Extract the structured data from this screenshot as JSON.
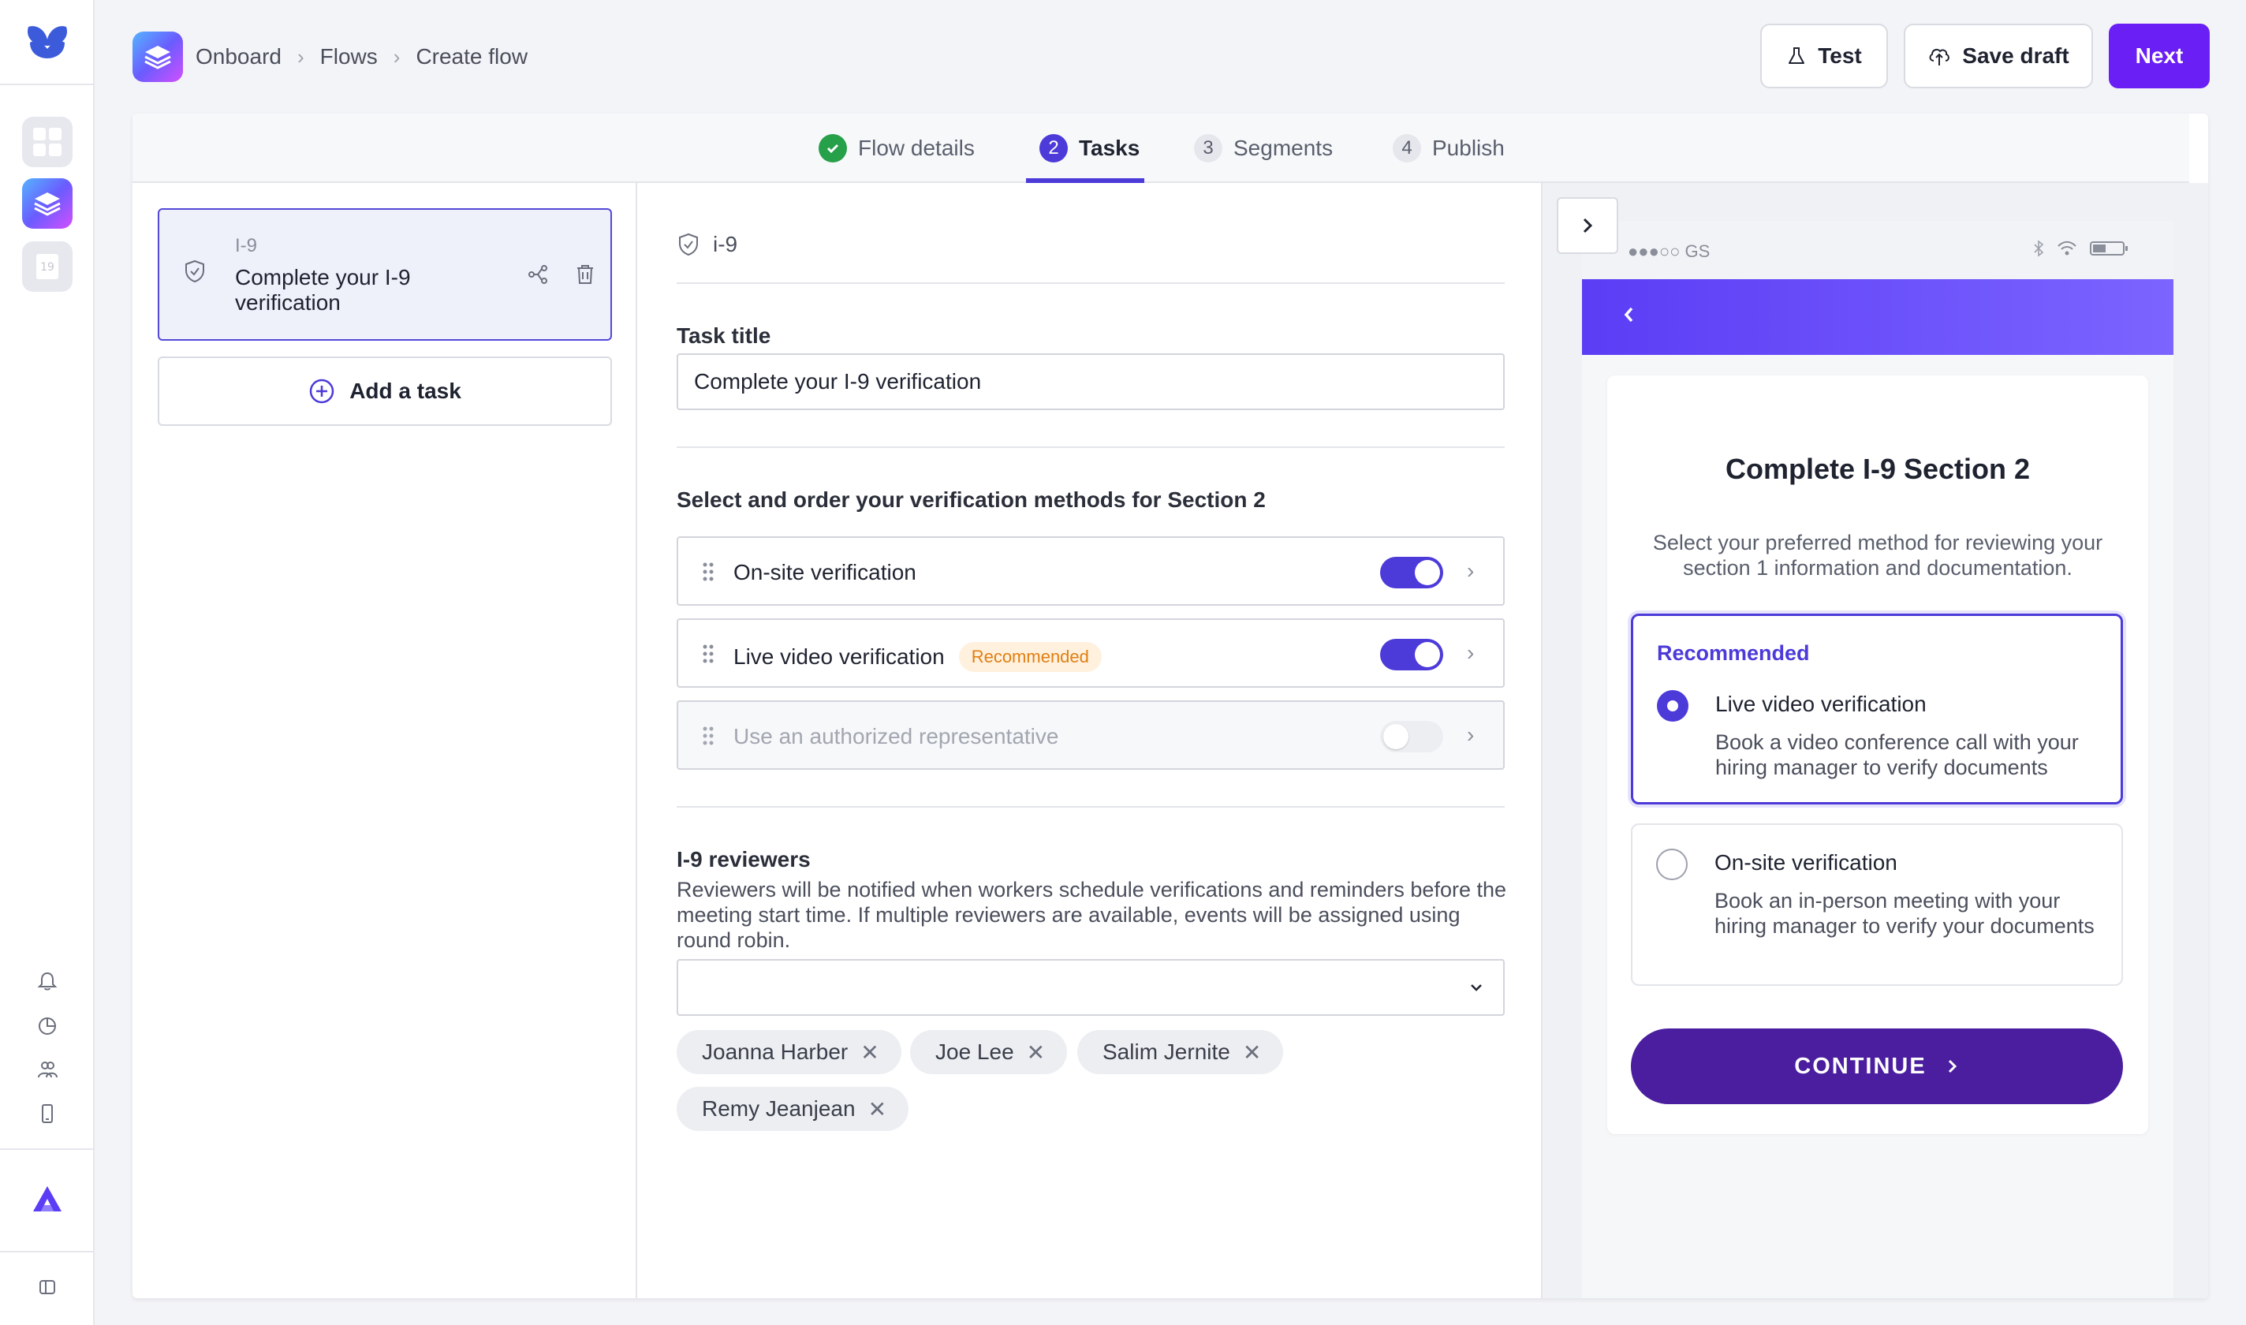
{
  "breadcrumb": [
    "Onboard",
    "Flows",
    "Create flow"
  ],
  "header": {
    "test_label": "Test",
    "save_draft_label": "Save draft",
    "next_label": "Next"
  },
  "steps": [
    {
      "num": "1",
      "label": "Flow details",
      "state": "done"
    },
    {
      "num": "2",
      "label": "Tasks",
      "state": "active"
    },
    {
      "num": "3",
      "label": "Segments",
      "state": "todo"
    },
    {
      "num": "4",
      "label": "Publish",
      "state": "todo"
    }
  ],
  "tasks": {
    "items": [
      {
        "tag": "I-9",
        "title": "Complete your I-9 verification"
      }
    ],
    "add_label": "Add a task"
  },
  "form": {
    "type_label": "i-9",
    "task_title_label": "Task title",
    "task_title_value": "Complete your I-9 verification",
    "methods_heading": "Select and order your verification methods for Section 2",
    "methods": [
      {
        "label": "On-site verification",
        "badge": "",
        "enabled": true
      },
      {
        "label": "Live video verification",
        "badge": "Recommended",
        "enabled": true
      },
      {
        "label": "Use an authorized representative",
        "badge": "",
        "enabled": false
      }
    ],
    "reviewers_label": "I-9 reviewers",
    "reviewers_desc": "Reviewers will be notified when workers schedule verifications and reminders before the meeting start time. If multiple reviewers are available, events will be assigned using round robin.",
    "reviewers_select_value": "",
    "reviewers": [
      "Joanna Harber",
      "Joe Lee",
      "Salim Jernite",
      "Remy Jeanjean"
    ]
  },
  "preview": {
    "carrier": "●●●○○ GS",
    "title": "Complete I-9 Section 2",
    "subtitle": "Select your preferred method for reviewing your section 1 information and documentation.",
    "recommended_label": "Recommended",
    "options": [
      {
        "title": "Live video verification",
        "desc": "Book a video conference call with your hiring manager to verify documents",
        "selected": true
      },
      {
        "title": "On-site verification",
        "desc": "Book an in-person meeting with your hiring manager to verify your documents",
        "selected": false
      }
    ],
    "continue_label": "CONTINUE"
  },
  "colors": {
    "accent": "#4c3ad9",
    "primary_button": "#6a1ff5",
    "continue_button": "#4a1e9e",
    "success": "#27a04a",
    "badge_text": "#e07f12"
  }
}
